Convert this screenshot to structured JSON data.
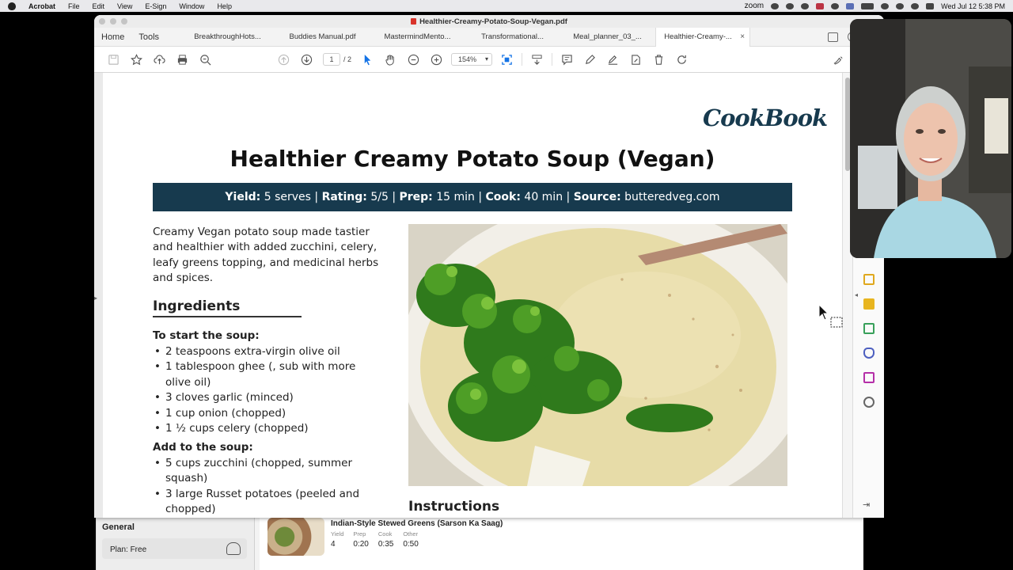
{
  "menubar": {
    "app": "Acrobat",
    "items": [
      "File",
      "Edit",
      "View",
      "E-Sign",
      "Window",
      "Help"
    ],
    "zoom_label": "zoom",
    "datetime": "Wed Jul 12  5:38 PM"
  },
  "window": {
    "title": "Healthier-Creamy-Potato-Soup-Vegan.pdf"
  },
  "tabs": {
    "home": "Home",
    "tools": "Tools",
    "docs": [
      "BreakthroughHots...",
      "Buddies Manual.pdf",
      "MastermindMento...",
      "Transformational...",
      "Meal_planner_03_...",
      "Healthier-Creamy-..."
    ],
    "close": "×"
  },
  "toolbar": {
    "page_current": "1",
    "page_total": "/ 2",
    "zoom": "154%"
  },
  "document": {
    "brand": "CookBook",
    "title": "Healthier Creamy Potato Soup (Vegan)",
    "info": {
      "yield_label": "Yield:",
      "yield_value": "5 serves",
      "rating_label": "Rating:",
      "rating_value": "5/5",
      "prep_label": "Prep:",
      "prep_value": "15 min",
      "cook_label": "Cook:",
      "cook_value": "40 min",
      "source_label": "Source:",
      "source_value": "butteredveg.com",
      "separator": "|"
    },
    "intro": "Creamy Vegan potato soup made tastier and healthier with added zucchini, celery, leafy greens topping, and medicinal herbs and spices.",
    "ingredients_heading": "Ingredients",
    "section1": "To start the soup:",
    "section1_items": [
      "2 teaspoons extra-virgin olive oil",
      "1 tablespoon ghee (, sub with more olive oil)",
      "3 cloves garlic (minced)",
      "1 cup onion (chopped)",
      "1 ½ cups celery (chopped)"
    ],
    "section2": "Add to the soup:",
    "section2_items": [
      "5 cups zucchini (chopped, summer squash)",
      "3 large Russet potatoes (peeled and chopped)"
    ],
    "instructions_heading": "Instructions"
  },
  "background_app": {
    "section": "General",
    "plan": "Plan: Free",
    "recipe_title": "Indian-Style Stewed Greens (Sarson Ka Saag)",
    "meta": [
      {
        "label": "Yield",
        "value": "4"
      },
      {
        "label": "Prep",
        "value": "0:20"
      },
      {
        "label": "Cook",
        "value": "0:35"
      },
      {
        "label": "Other",
        "value": "0:50"
      }
    ]
  },
  "colors": {
    "brand_navy": "#173a4e",
    "pdf_red": "#d9342b",
    "acrobat_blue": "#1473e6"
  }
}
